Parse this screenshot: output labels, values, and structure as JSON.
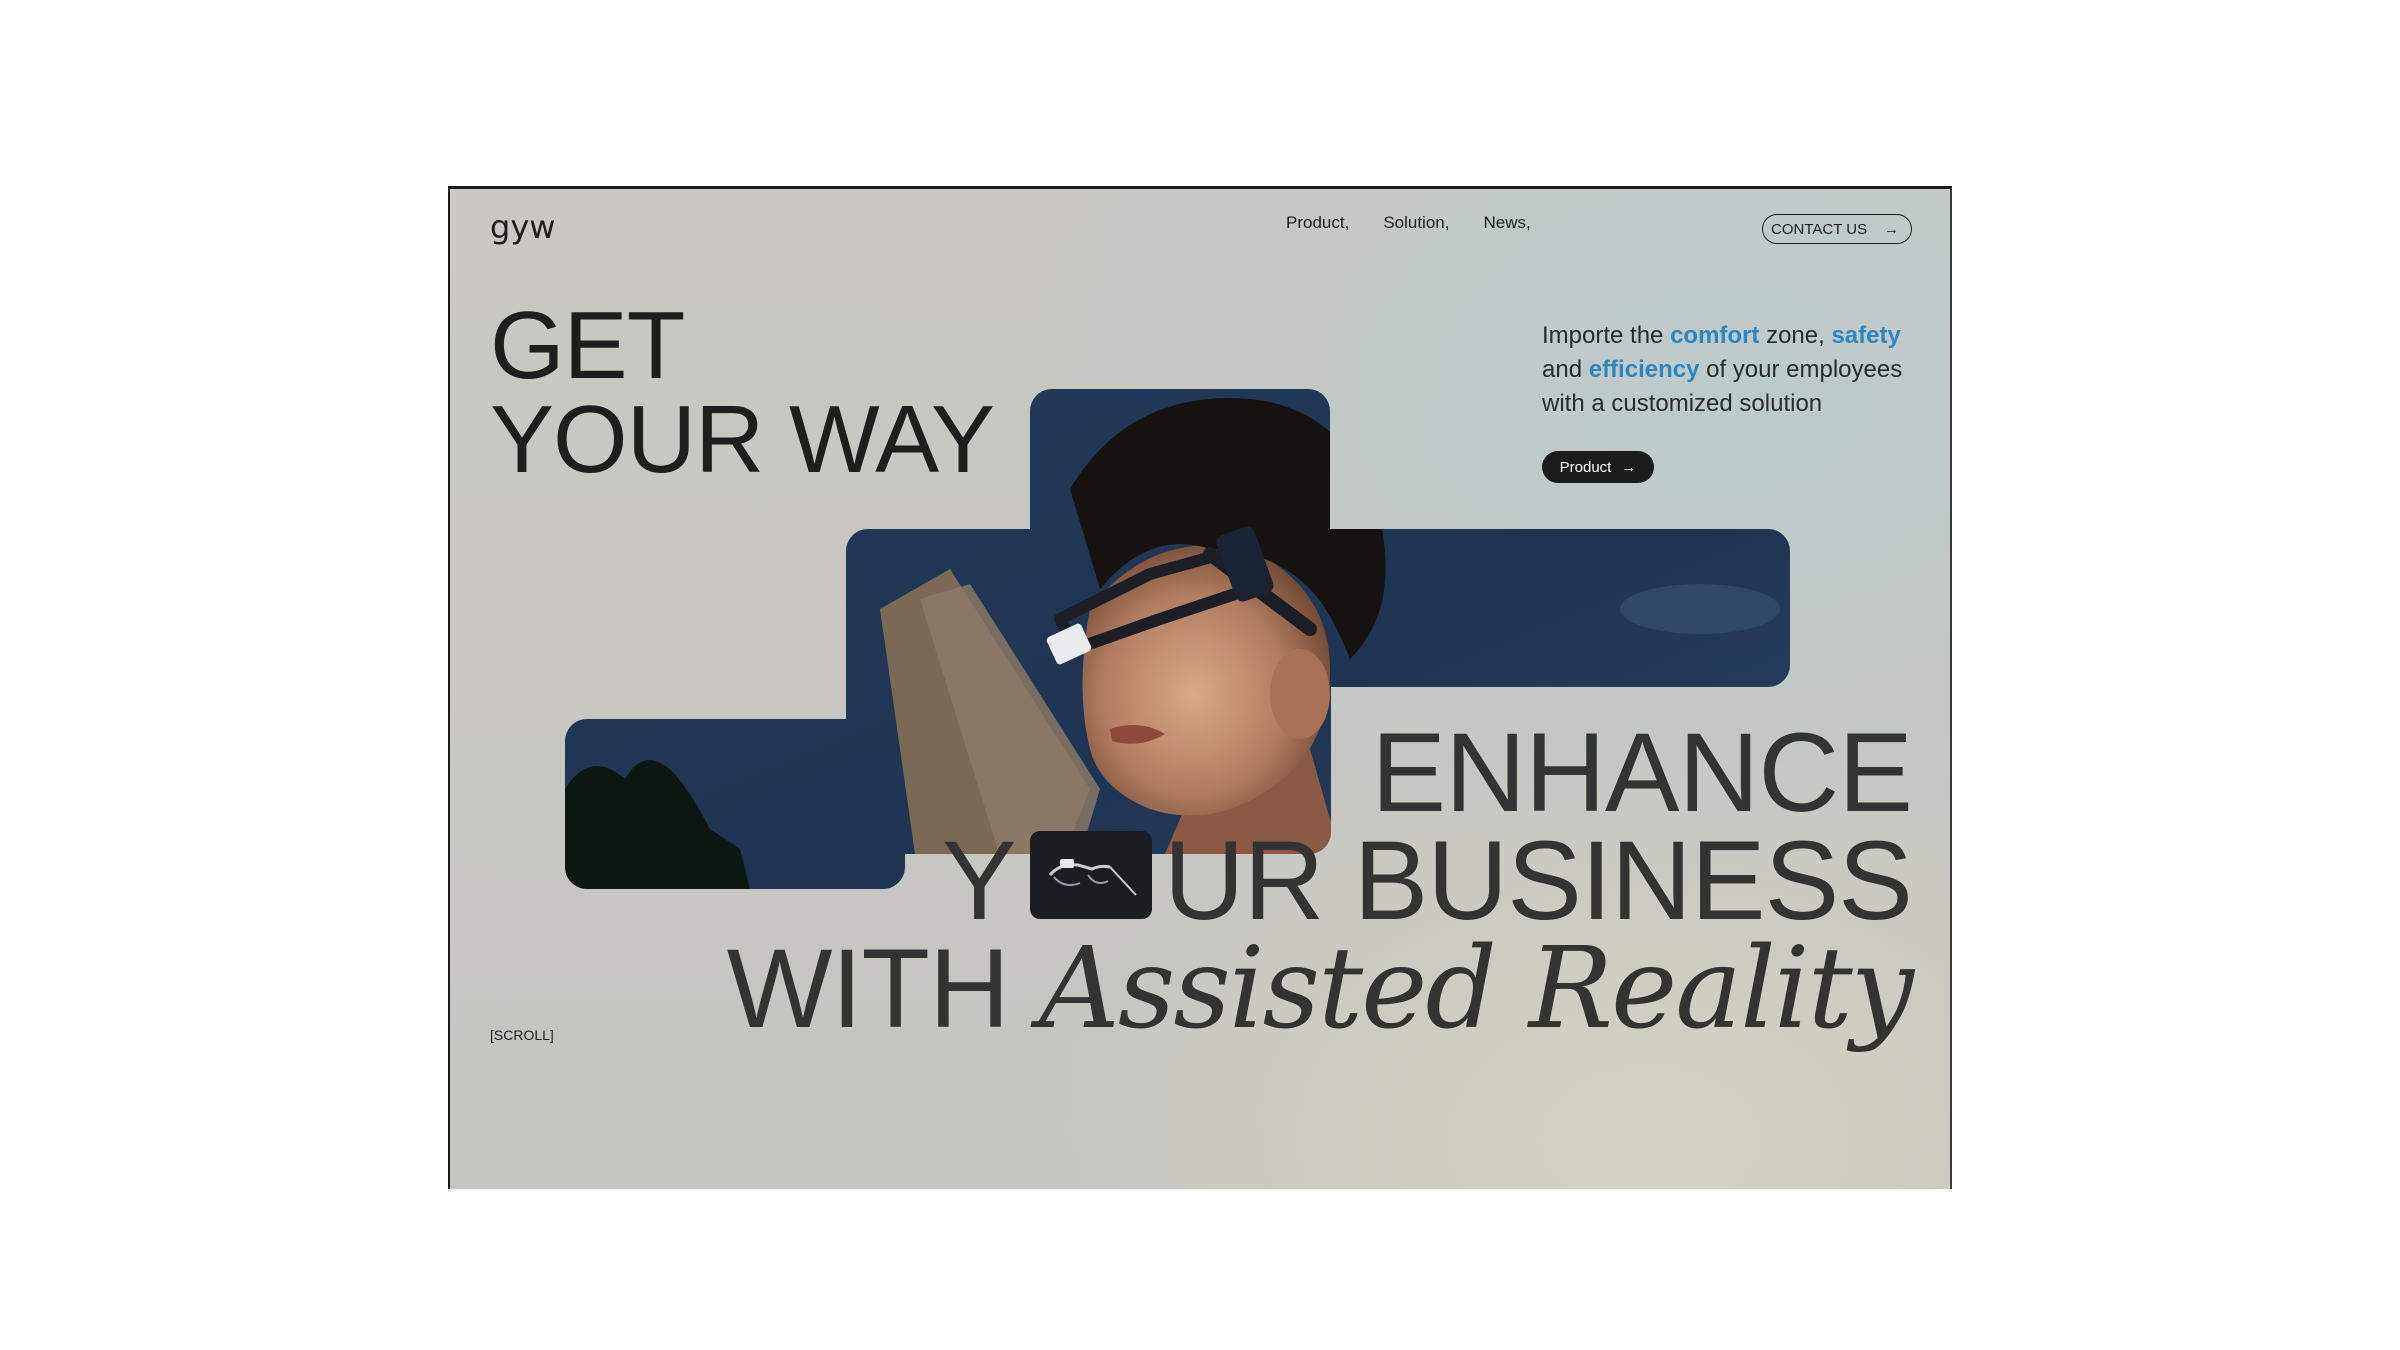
{
  "brand": {
    "logo_text": "gyw"
  },
  "nav": {
    "items": [
      "Product,",
      "Solution,",
      "News,"
    ]
  },
  "contact": {
    "label": "CONTACT US",
    "icon": "arrow-right-icon"
  },
  "hero_top": {
    "line1": "GET",
    "line2": "YOUR WAY"
  },
  "tagline": {
    "p1": "Importe the ",
    "h1": "comfort",
    "p2": " zone, ",
    "h2": "safety",
    "p3": " and ",
    "h3": "efficiency",
    "p4": " of your employees with a customized solution"
  },
  "product_button": {
    "label": "Product",
    "icon": "arrow-right-icon"
  },
  "hero_bottom": {
    "line1": "ENHANCE",
    "line2_prefix": "Y",
    "line2_suffix": "UR BUSINESS",
    "line3_prefix": "WITH ",
    "line3_serif": "Assisted Reality"
  },
  "scroll": {
    "label": "[SCROLL]"
  },
  "colors": {
    "accent": "#2f86bf",
    "text": "#1e1e1e",
    "dark_button": "#1b1b1b",
    "sky": "#1f3550"
  }
}
